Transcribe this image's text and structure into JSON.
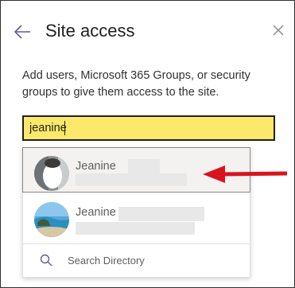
{
  "header": {
    "title": "Site access",
    "back_icon": "arrow-left-icon",
    "close_icon": "close-icon"
  },
  "description": "Add users, Microsoft 365 Groups, or security groups to give them access to the site.",
  "search": {
    "value": "jeanine",
    "placeholder": ""
  },
  "results": [
    {
      "name": "Jeanine",
      "avatar_icon": "person-photo-icon",
      "selected": true
    },
    {
      "name": "Jeanine",
      "avatar_icon": "beach-photo-icon",
      "selected": false
    }
  ],
  "search_directory": {
    "label": "Search Directory",
    "icon": "search-icon"
  },
  "colors": {
    "input_highlight": "#fce86a",
    "annotation_arrow": "#d9141e",
    "accent": "#605e9a"
  }
}
